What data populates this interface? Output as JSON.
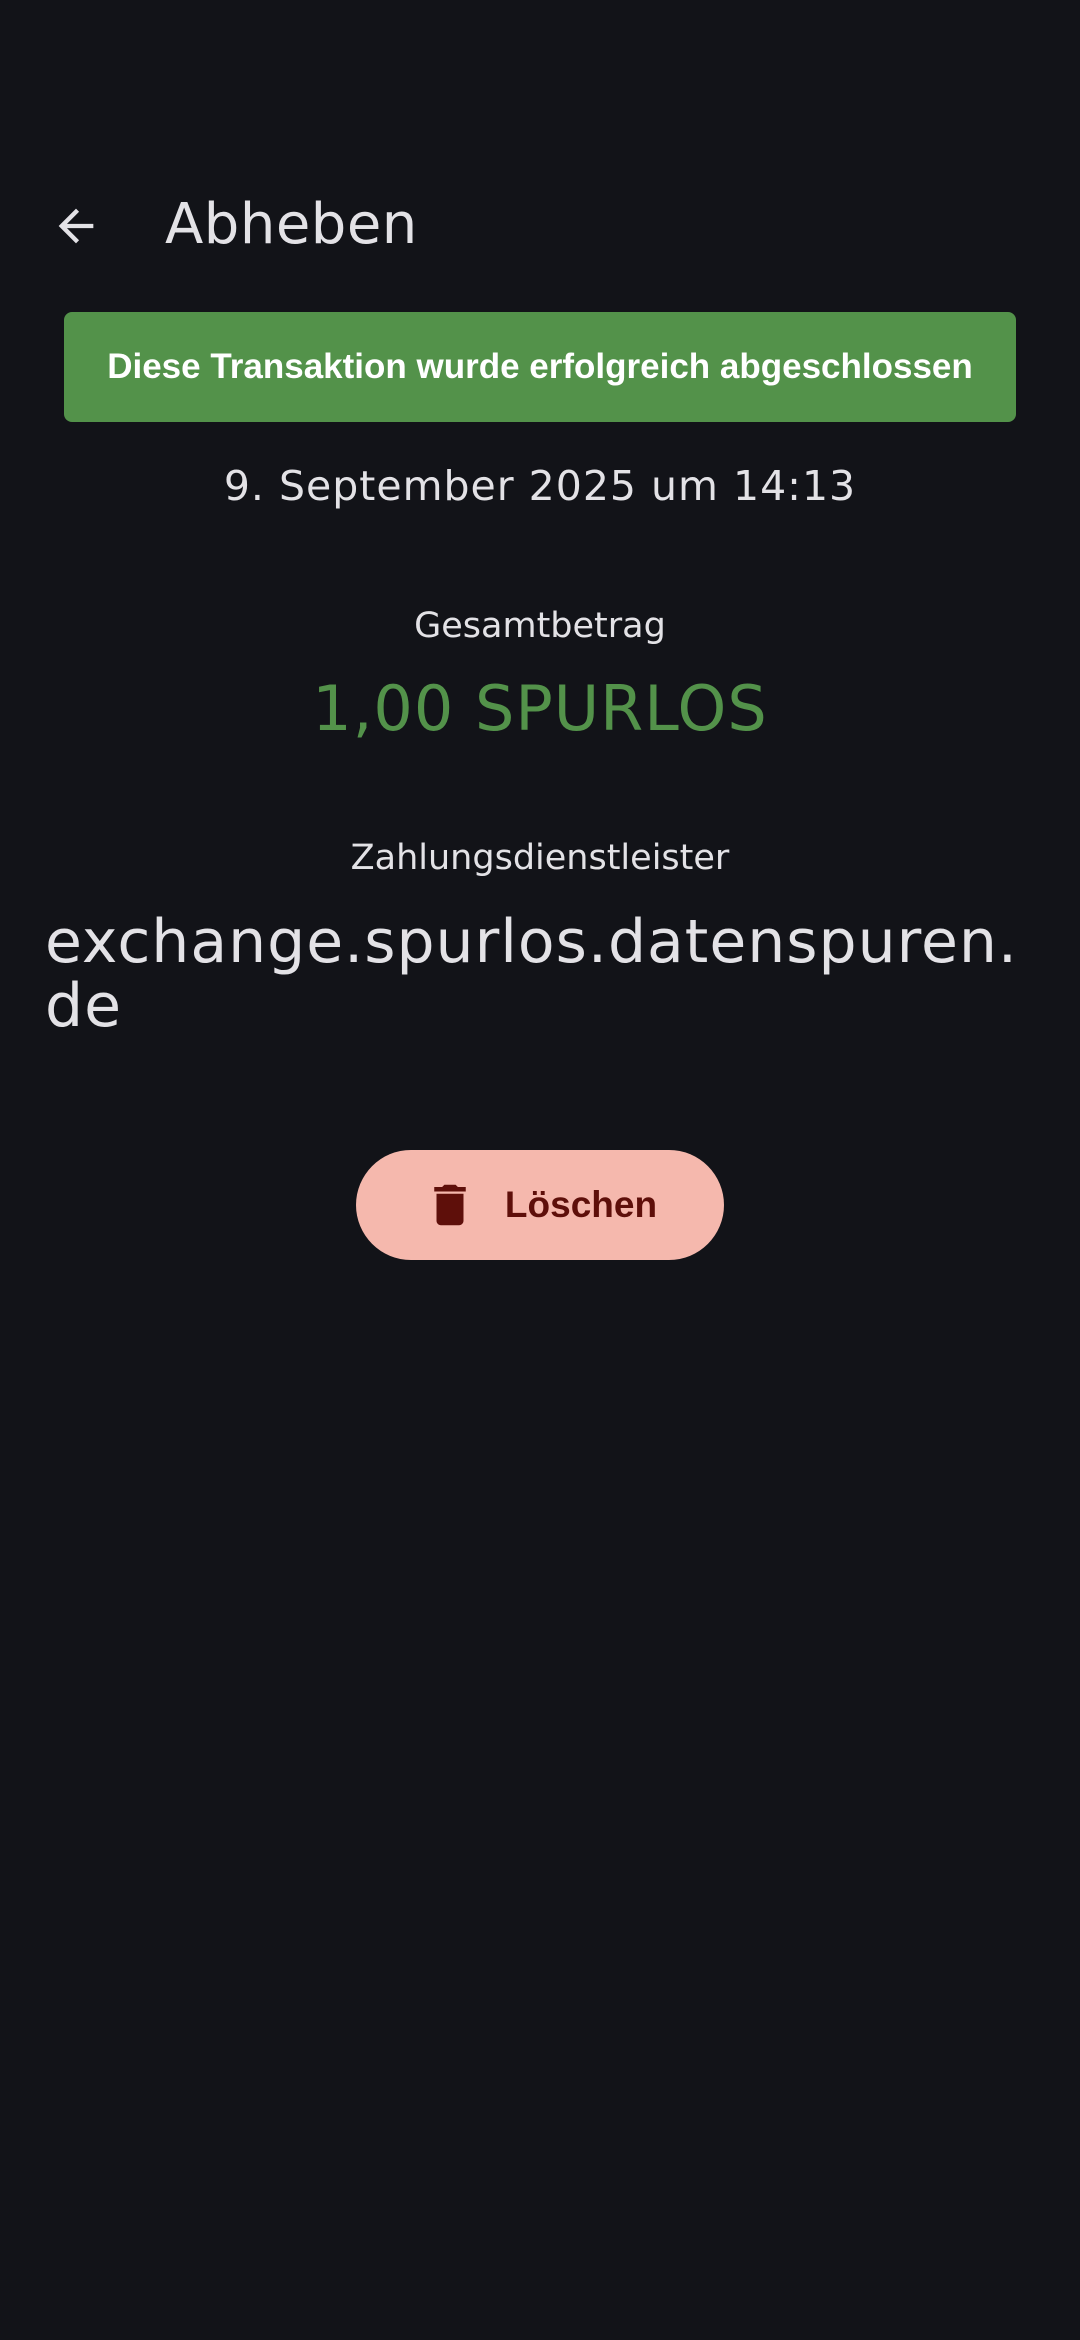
{
  "app_bar": {
    "title": "Abheben",
    "back_icon": "arrow-back-icon"
  },
  "status": {
    "message": "Diese Transaktion wurde erfolgreich abgeschlossen",
    "color": "#53924a"
  },
  "transaction": {
    "timestamp": "9. September 2025 um 14:13",
    "total_label": "Gesamtbetrag",
    "total_amount": "1,00 SPURLOS",
    "amount_color": "#53924a",
    "provider_label": "Zahlungsdienstleister",
    "provider_value": "exchange.spurlos.datenspuren.de"
  },
  "actions": {
    "delete_label": "Löschen",
    "delete_icon": "trash-icon",
    "delete_bg": "#f5b8ad",
    "delete_fg": "#5e0f0a"
  }
}
